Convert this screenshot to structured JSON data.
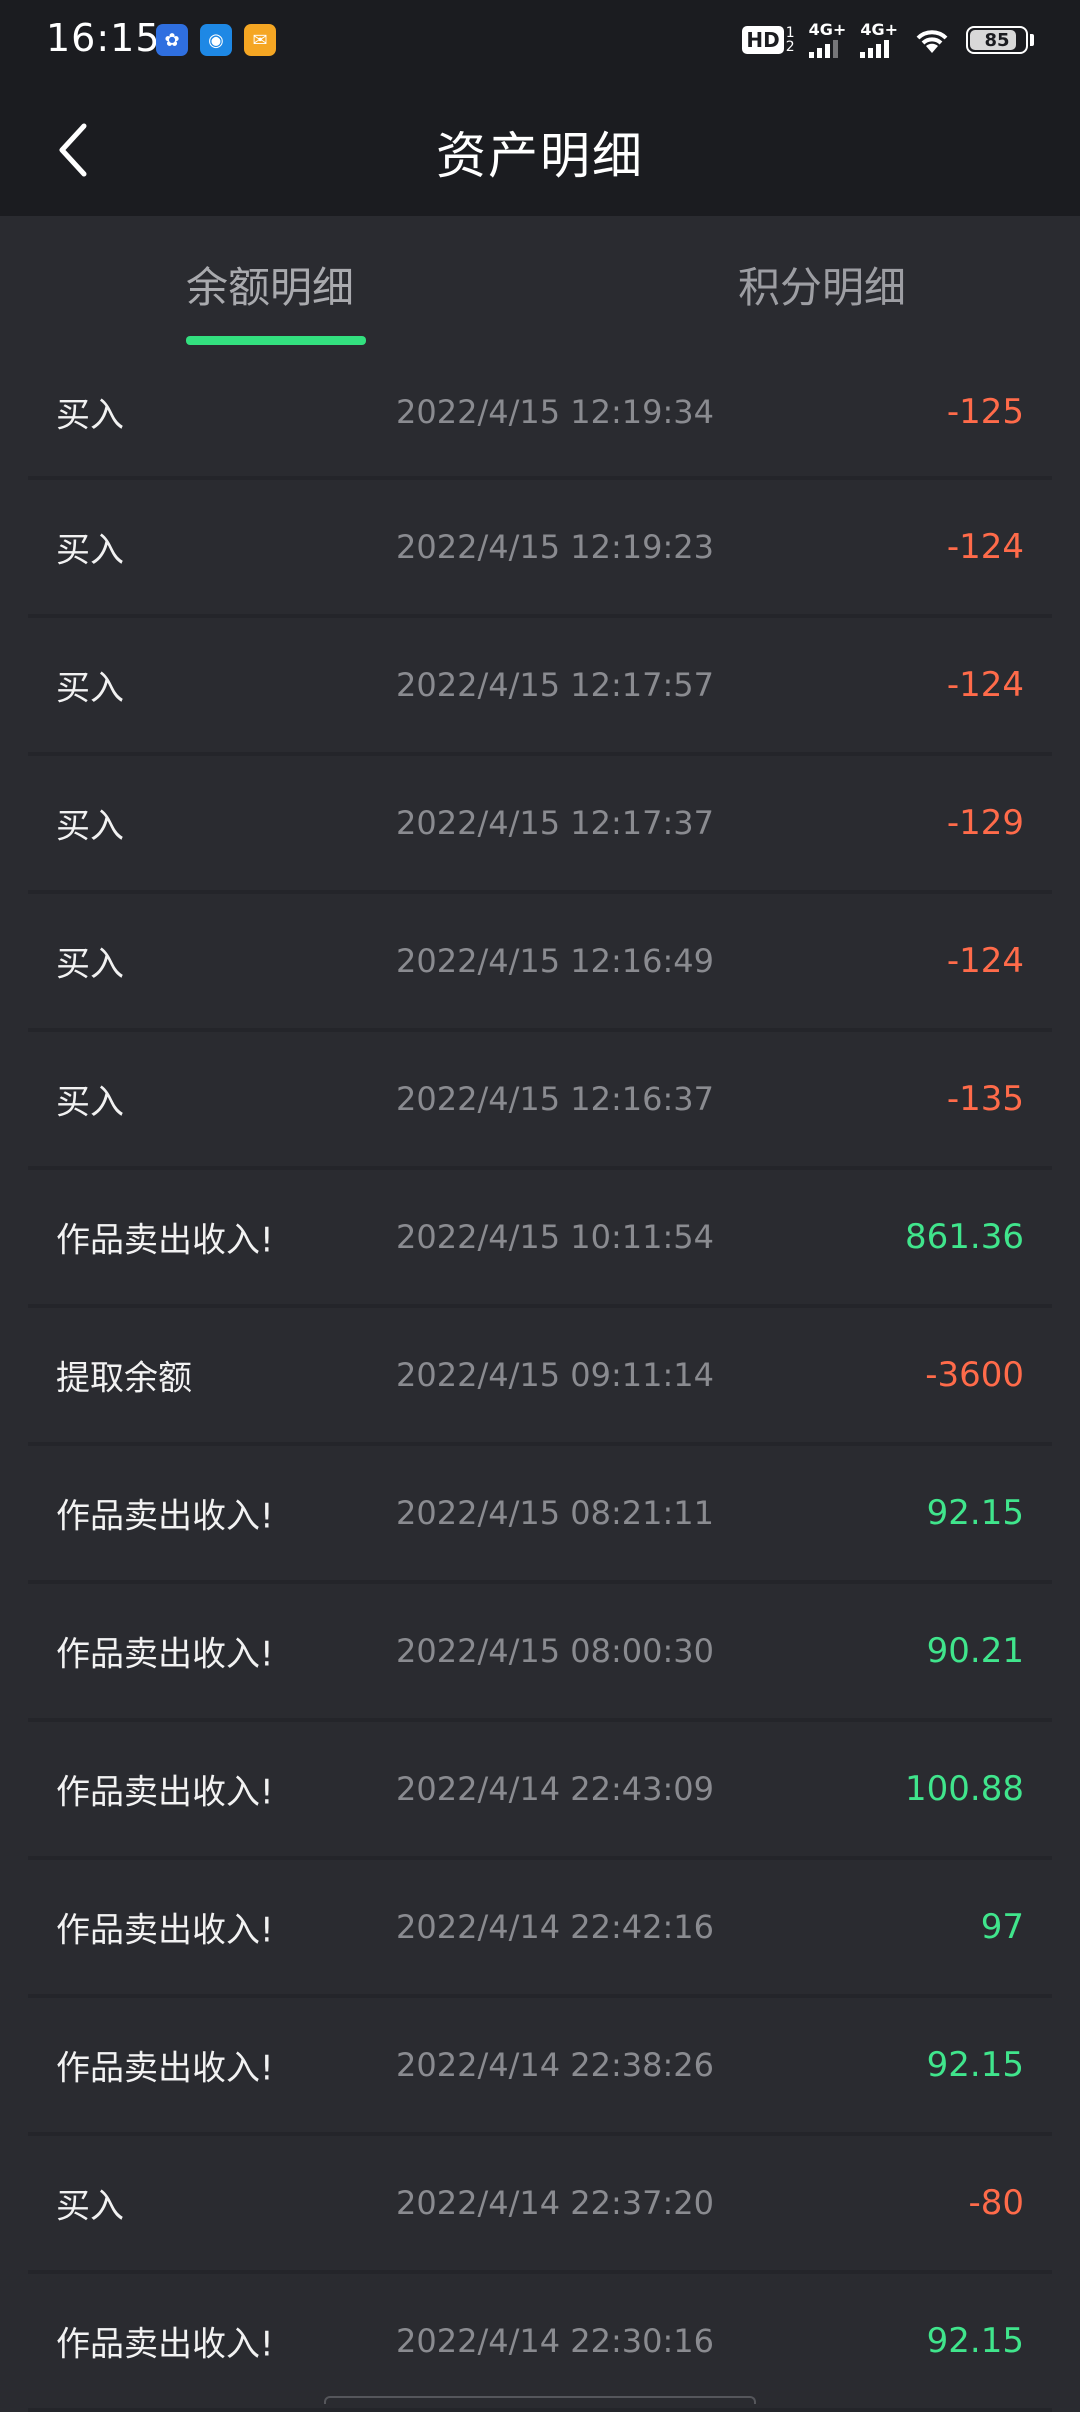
{
  "status_bar": {
    "time": "16:15",
    "app_icons": [
      "baidu-icon",
      "wifi-app-icon",
      "mail-icon"
    ],
    "hd_label": "HD",
    "hd_sub": "2",
    "hd_sup": "1",
    "signal1_label": "4G+",
    "signal2_label": "4G+",
    "battery": "85"
  },
  "header": {
    "title": "资产明细"
  },
  "tabs": [
    {
      "label": "余额明细",
      "active": true
    },
    {
      "label": "积分明细",
      "active": false
    }
  ],
  "colors": {
    "negative": "#ff6b4a",
    "positive": "#40e58c",
    "accent": "#33e07f"
  },
  "transactions": [
    {
      "type": "买入",
      "time": "2022/4/15 12:19:34",
      "amount": "-125",
      "sign": "neg"
    },
    {
      "type": "买入",
      "time": "2022/4/15 12:19:23",
      "amount": "-124",
      "sign": "neg"
    },
    {
      "type": "买入",
      "time": "2022/4/15 12:17:57",
      "amount": "-124",
      "sign": "neg"
    },
    {
      "type": "买入",
      "time": "2022/4/15 12:17:37",
      "amount": "-129",
      "sign": "neg"
    },
    {
      "type": "买入",
      "time": "2022/4/15 12:16:49",
      "amount": "-124",
      "sign": "neg"
    },
    {
      "type": "买入",
      "time": "2022/4/15 12:16:37",
      "amount": "-135",
      "sign": "neg"
    },
    {
      "type": "作品卖出收入!",
      "time": "2022/4/15 10:11:54",
      "amount": "861.36",
      "sign": "pos"
    },
    {
      "type": "提取余额",
      "time": "2022/4/15 09:11:14",
      "amount": "-3600",
      "sign": "neg"
    },
    {
      "type": "作品卖出收入!",
      "time": "2022/4/15 08:21:11",
      "amount": "92.15",
      "sign": "pos"
    },
    {
      "type": "作品卖出收入!",
      "time": "2022/4/15 08:00:30",
      "amount": "90.21",
      "sign": "pos"
    },
    {
      "type": "作品卖出收入!",
      "time": "2022/4/14 22:43:09",
      "amount": "100.88",
      "sign": "pos"
    },
    {
      "type": "作品卖出收入!",
      "time": "2022/4/14 22:42:16",
      "amount": "97",
      "sign": "pos"
    },
    {
      "type": "作品卖出收入!",
      "time": "2022/4/14 22:38:26",
      "amount": "92.15",
      "sign": "pos"
    },
    {
      "type": "买入",
      "time": "2022/4/14 22:37:20",
      "amount": "-80",
      "sign": "neg"
    },
    {
      "type": "作品卖出收入!",
      "time": "2022/4/14 22:30:16",
      "amount": "92.15",
      "sign": "pos"
    }
  ]
}
